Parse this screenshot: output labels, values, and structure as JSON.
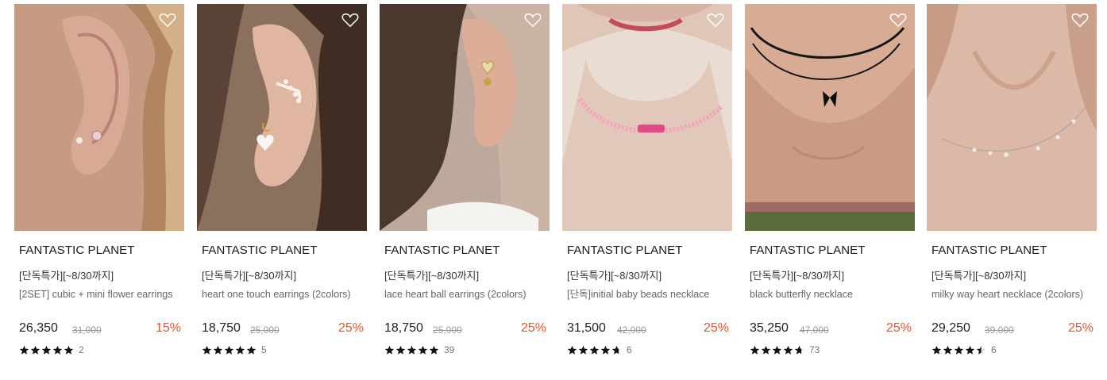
{
  "products": [
    {
      "brand": "FANTASTIC PLANET",
      "promo": "[단독특가][~8/30까지]",
      "name": "[2SET] cubic + mini flower earrings",
      "price": "26,350",
      "original_price": "31,000",
      "discount": "15%",
      "rating": 5,
      "review_count": "2",
      "image": "ear-stud-earrings-photo"
    },
    {
      "brand": "FANTASTIC PLANET",
      "promo": "[단독특가][~8/30까지]",
      "name": "heart one touch earrings (2colors)",
      "price": "18,750",
      "original_price": "25,000",
      "discount": "25%",
      "rating": 5,
      "review_count": "5",
      "image": "ear-pearl-heart-earrings-photo"
    },
    {
      "brand": "FANTASTIC PLANET",
      "promo": "[단독특가][~8/30까지]",
      "name": "lace heart ball earrings (2colors)",
      "price": "18,750",
      "original_price": "25,000",
      "discount": "25%",
      "rating": 5,
      "review_count": "39",
      "image": "ear-lace-heart-earrings-photo"
    },
    {
      "brand": "FANTASTIC PLANET",
      "promo": "[단독특가][~8/30까지]",
      "name": "[단독]initial baby beads necklace",
      "price": "31,500",
      "original_price": "42,000",
      "discount": "25%",
      "rating": 4.7,
      "review_count": "6",
      "image": "neck-beads-necklace-photo"
    },
    {
      "brand": "FANTASTIC PLANET",
      "promo": "[단독특가][~8/30까지]",
      "name": "black butterfly necklace",
      "price": "35,250",
      "original_price": "47,000",
      "discount": "25%",
      "rating": 4.7,
      "review_count": "73",
      "image": "neck-butterfly-necklace-photo"
    },
    {
      "brand": "FANTASTIC PLANET",
      "promo": "[단독특가][~8/30까지]",
      "name": "milky way heart necklace (2colors)",
      "price": "29,250",
      "original_price": "39,000",
      "discount": "25%",
      "rating": 4.5,
      "review_count": "6",
      "image": "neck-milky-way-necklace-photo"
    }
  ],
  "colors": {
    "discount": "#e8552b",
    "star": "#111111",
    "text": "#222222",
    "muted": "#999999"
  }
}
